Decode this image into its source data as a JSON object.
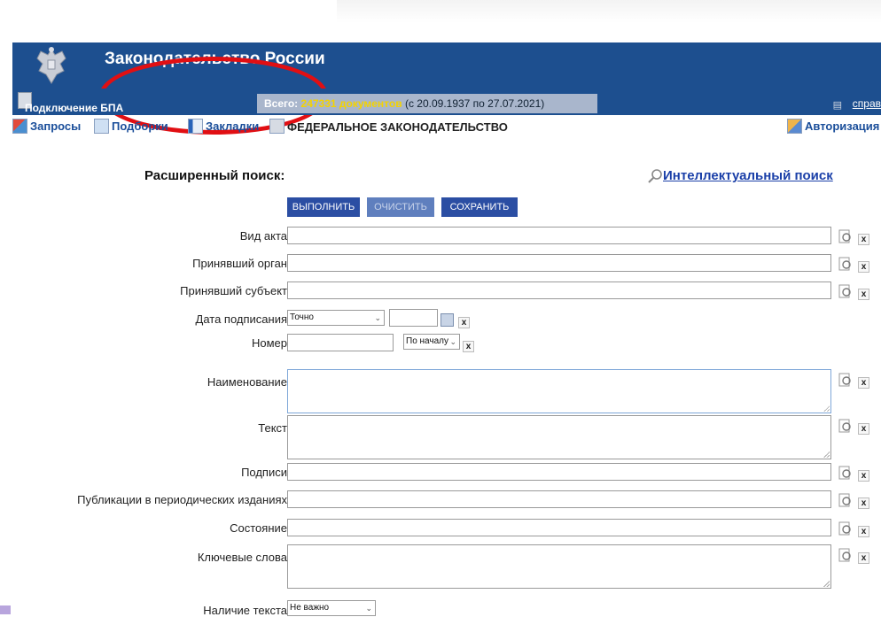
{
  "header": {
    "title": "Законодательство России"
  },
  "infobar": {
    "bpa_label": "Подключение БПА",
    "total_label": "Всего:",
    "total_count": "247331 документов",
    "total_range": "(с 20.09.1937 по 27.07.2021)",
    "help_link": "справ"
  },
  "menu": {
    "requests": "Запросы",
    "selections": "Подборки",
    "bookmarks": "Закладки",
    "federal": "ФЕДЕРАЛЬНОЕ ЗАКОНОДАТЕЛЬСТВО",
    "auth": "Авторизация"
  },
  "search": {
    "title": "Расширенный поиск:",
    "intel_link": "Интеллектуальный поиск",
    "btn_execute": "ВЫПОЛНИТЬ",
    "btn_clear": "ОЧИСТИТЬ",
    "btn_save": "СОХРАНИТЬ"
  },
  "fields": {
    "act_type": "Вид акта",
    "organ": "Принявший орган",
    "subject": "Принявший субъект",
    "sign_date": "Дата подписания",
    "number": "Номер",
    "name": "Наименование",
    "text": "Текст",
    "signatures": "Подписи",
    "publications": "Публикации в периодических изданиях",
    "status": "Состояние",
    "keywords": "Ключевые слова",
    "has_text": "Наличие текста"
  },
  "selects": {
    "date_mode": "Точно",
    "number_mode": "По началу",
    "has_text_mode": "Не важно"
  },
  "icons": {
    "clear": "x"
  }
}
